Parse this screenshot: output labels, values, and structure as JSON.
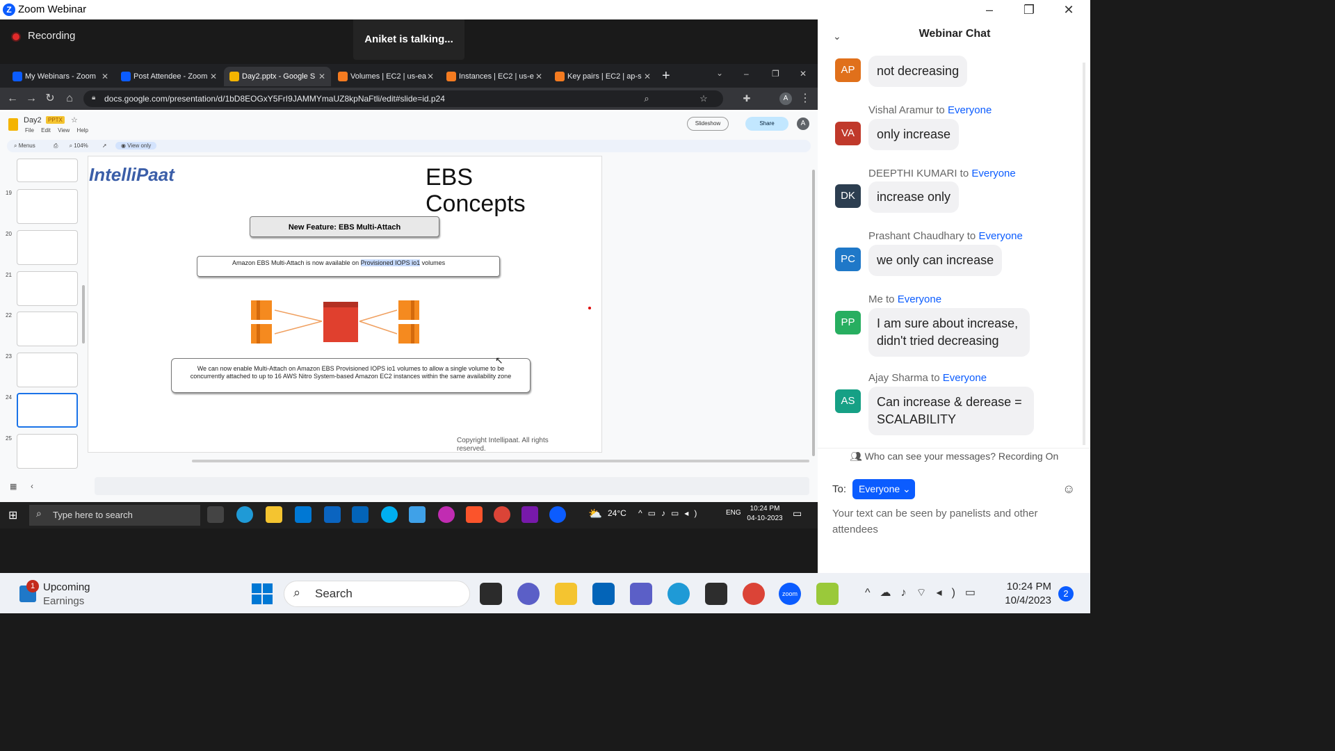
{
  "window": {
    "title": "Zoom Webinar",
    "minimize": "–",
    "restore": "❐",
    "close": "✕"
  },
  "recording": {
    "label": "Recording"
  },
  "talking": {
    "label": "Aniket is talking..."
  },
  "browser": {
    "tabs": [
      {
        "label": "My Webinars - Zoom",
        "icon_color": "#0b5cff"
      },
      {
        "label": "Post Attendee - Zoom",
        "icon_color": "#0b5cff"
      },
      {
        "label": "Day2.pptx - Google S",
        "icon_color": "#f4b400"
      },
      {
        "label": "Volumes | EC2 | us-ea",
        "icon_color": "#f47b20"
      },
      {
        "label": "Instances | EC2 | us-e",
        "icon_color": "#f47b20"
      },
      {
        "label": "Key pairs | EC2 | ap-s",
        "icon_color": "#f47b20"
      }
    ],
    "new_tab": "+",
    "url": "docs.google.com/presentation/d/1bD8EOGxY5FrI9JAMMYmaUZ8kpNaFtli/edit#slide=id.p24"
  },
  "slides_app": {
    "doc_name": "Day2",
    "doc_type": "PPTX",
    "menu": "File Edit View Help",
    "toolbar": {
      "menus": "Menus",
      "zoom": "104%",
      "view_only": "View only"
    },
    "slideshow": "Slideshow",
    "share": "Share",
    "thumb_numbers": [
      "19",
      "20",
      "21",
      "22",
      "23",
      "24",
      "25"
    ],
    "selected_slide": "24"
  },
  "slide": {
    "logo_part1": "I",
    "logo_part2": "ntelliPaat",
    "title": "EBS Concepts",
    "feature_box": "New Feature: EBS Multi-Attach",
    "avail_text_a": "Amazon EBS Multi-Attach is now available on ",
    "avail_text_b": "Provisioned IOPS io1",
    "avail_text_c": " volumes",
    "description": "We can now enable Multi-Attach on Amazon EBS Provisioned IOPS io1 volumes to allow a single volume to be concurrently attached to up to 16 AWS Nitro System-based Amazon EC2 instances within the same availability zone",
    "copyright": "Copyright Intellipaat. All rights reserved."
  },
  "win10_taskbar": {
    "search": "Type here to search",
    "temp": "24°C",
    "lang": "ENG",
    "time": "10:24 PM",
    "date": "04-10-2023"
  },
  "win11_taskbar": {
    "widget_title": "Upcoming",
    "widget_sub": "Earnings",
    "widget_badge": "1",
    "search": "Search",
    "time": "10:24 PM",
    "date": "10/4/2023",
    "notif_count": "2"
  },
  "chat": {
    "title": "Webinar Chat",
    "messages": [
      {
        "initials": "AP",
        "color": "#e0701b",
        "sender": "",
        "to": "",
        "text": "not decreasing"
      },
      {
        "initials": "VA",
        "color": "#c0392b",
        "sender": "Vishal Aramur to ",
        "to": "Everyone",
        "text": "only increase"
      },
      {
        "initials": "DK",
        "color": "#2c3e50",
        "sender": "DEEPTHI KUMARI to ",
        "to": "Everyone",
        "text": "increase only"
      },
      {
        "initials": "PC",
        "color": "#1f78c8",
        "sender": "Prashant Chaudhary to ",
        "to": "Everyone",
        "text": "we only can increase"
      },
      {
        "initials": "PP",
        "color": "#27ae60",
        "sender": "Me to ",
        "to": "Everyone",
        "text": "I am sure about increase, didn't tried decreasing"
      },
      {
        "initials": "AS",
        "color": "#16a085",
        "sender": "Ajay Sharma to ",
        "to": "Everyone",
        "text": "Can increase & derease = SCALABILITY"
      }
    ],
    "who_can_see": "Who can see your messages? Recording On",
    "to_label": "To:",
    "to_value": "Everyone",
    "input_placeholder": "Your text can be seen by panelists and other attendees"
  }
}
